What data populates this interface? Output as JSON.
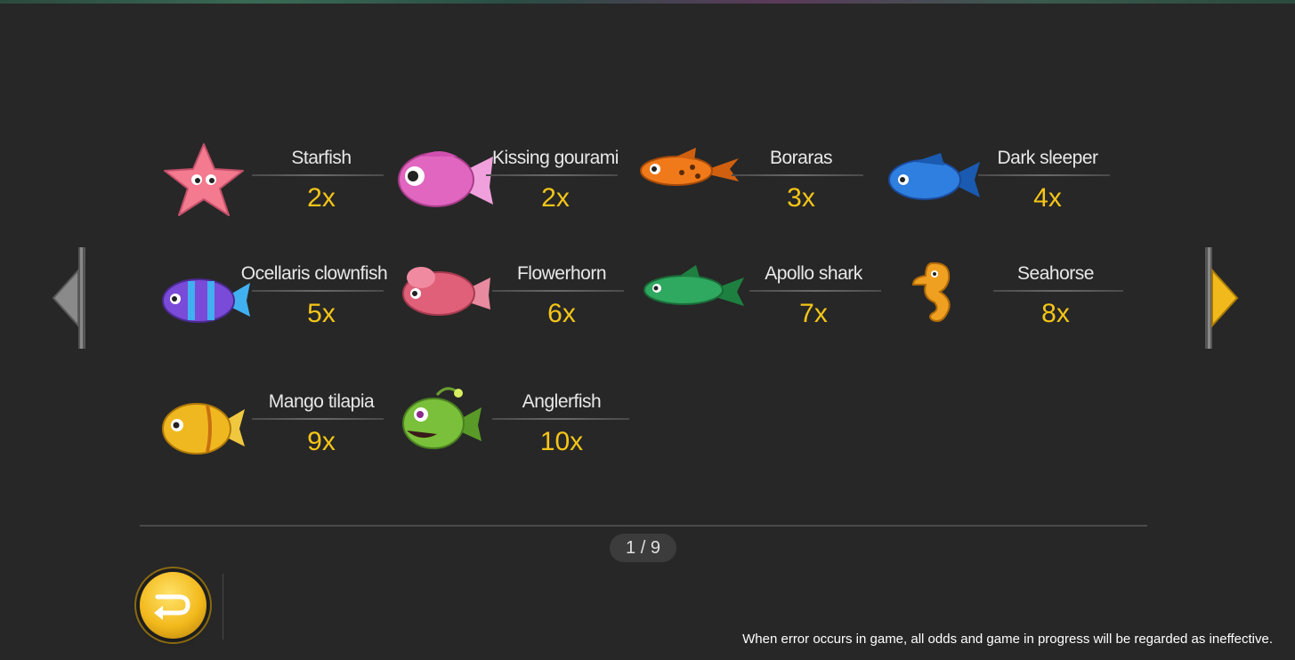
{
  "fish": [
    {
      "name": "Starfish",
      "odds": "2x",
      "icon": "starfish-icon",
      "color": "#f47a8f"
    },
    {
      "name": "Kissing gourami",
      "odds": "2x",
      "icon": "kissing-gourami-icon",
      "color": "#e066c0"
    },
    {
      "name": "Boraras",
      "odds": "3x",
      "icon": "boraras-icon",
      "color": "#f07a1a"
    },
    {
      "name": "Dark sleeper",
      "odds": "4x",
      "icon": "dark-sleeper-icon",
      "color": "#2f7fe0"
    },
    {
      "name": "Ocellaris clownfish",
      "odds": "5x",
      "icon": "ocellaris-clownfish-icon",
      "color": "#7a4ad8"
    },
    {
      "name": "Flowerhorn",
      "odds": "6x",
      "icon": "flowerhorn-icon",
      "color": "#e0607a"
    },
    {
      "name": "Apollo shark",
      "odds": "7x",
      "icon": "apollo-shark-icon",
      "color": "#2fa860"
    },
    {
      "name": "Seahorse",
      "odds": "8x",
      "icon": "seahorse-icon",
      "color": "#f0a020"
    },
    {
      "name": "Mango tilapia",
      "odds": "9x",
      "icon": "mango-tilapia-icon",
      "color": "#f0b820"
    },
    {
      "name": "Anglerfish",
      "odds": "10x",
      "icon": "anglerfish-icon",
      "color": "#7ac03a"
    }
  ],
  "pagination": {
    "label": "1 / 9"
  },
  "nav": {
    "prev_icon": "left-arrow-icon",
    "next_icon": "right-arrow-icon"
  },
  "back_button": {
    "icon": "return-icon"
  },
  "disclaimer": "When error occurs in game, all odds and game in progress will be regarded as ineffective.",
  "colors": {
    "odds": "#f5c518",
    "background": "#272727",
    "accent_gold": "#f2b91c"
  }
}
